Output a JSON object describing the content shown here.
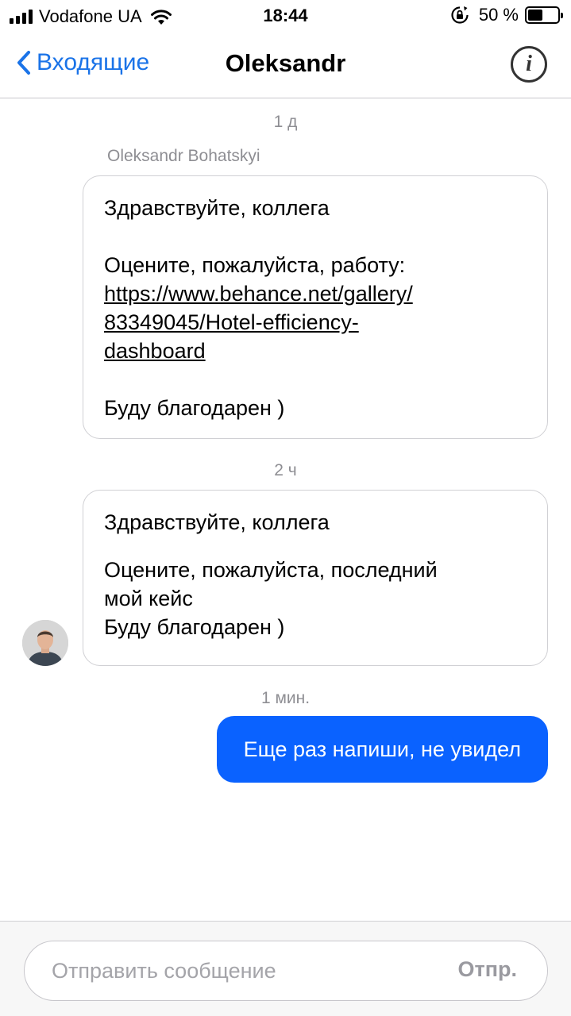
{
  "status_bar": {
    "carrier": "Vodafone UA",
    "time": "18:44",
    "battery_percent": "50 %",
    "battery_level": 0.5
  },
  "nav": {
    "back_label": "Входящие",
    "title": "Oleksandr",
    "info_icon": "i"
  },
  "conversation": {
    "sender_name": "Oleksandr Bohatskyi",
    "messages": [
      {
        "timestamp": "1 д",
        "greeting": "Здравствуйте, коллега",
        "request": "Оцените, пожалуйста, работу:",
        "link": "https://www.behance.net/gallery/83349045/Hotel-efficiency-dashboard",
        "link_line1": "https://www.behance.net/gallery/",
        "link_line2": "83349045/Hotel-efficiency-",
        "link_line3": "dashboard",
        "closing": "Буду благодарен )"
      },
      {
        "timestamp": "2 ч",
        "greeting": "Здравствуйте, коллега",
        "request_line1": "Оцените, пожалуйста, последний",
        "request_line2": "мой кейс",
        "closing": "Буду благодарен )"
      },
      {
        "timestamp": "1 мин.",
        "text": "Еще раз напиши, не увидел"
      }
    ]
  },
  "composer": {
    "placeholder": "Отправить сообщение",
    "send_label": "Отпр."
  },
  "colors": {
    "accent": "#1a73e8",
    "outgoing_bubble": "#0a62ff",
    "muted_text": "#8e8e93"
  }
}
